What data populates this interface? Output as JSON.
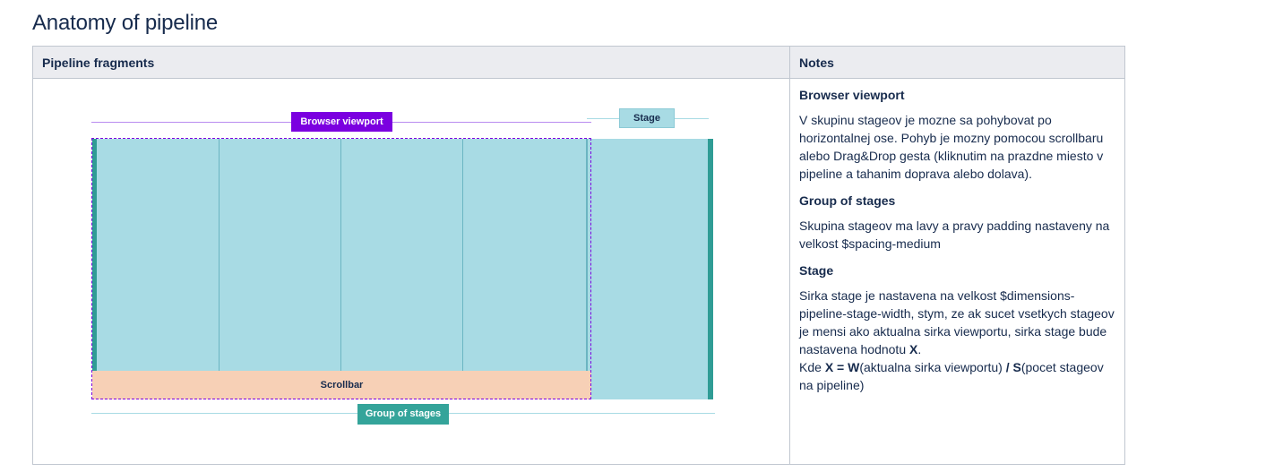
{
  "page": {
    "title": "Anatomy of pipeline"
  },
  "table": {
    "headers": [
      "Pipeline fragments",
      "Notes"
    ]
  },
  "diagram": {
    "labels": {
      "browser_viewport": "Browser viewport",
      "stage": "Stage",
      "scrollbar": "Scrollbar",
      "group_of_stages": "Group of stages"
    },
    "colors": {
      "viewport_purple": "#7b00e0",
      "stage_fill": "#a8dbe4",
      "stage_border": "#6bb5c2",
      "scrollbar_fill": "#f7d0b6",
      "group_teal": "#34a49a",
      "edge_teal": "#2f9c95"
    }
  },
  "notes": {
    "browser_viewport": {
      "heading": "Browser viewport",
      "text": "V skupinu stageov je mozne sa pohybovat po horizontalnej ose. Pohyb je mozny pomocou scrollbaru alebo Drag&Drop gesta (kliknutim na prazdne miesto v pipeline a tahanim doprava alebo dolava)."
    },
    "group_of_stages": {
      "heading": "Group of stages",
      "text": "Skupina stageov ma lavy a pravy padding nastaveny na velkost $spacing-medium"
    },
    "stage": {
      "heading": "Stage",
      "text": "Sirka stage je nastavena na velkost $dimensions-pipeline-stage-width, stym, ze ak sucet vsetkych stageov je mensi ako aktualna sirka viewportu, sirka stage bude nastavena hodnotu",
      "bold_x": "X",
      "period": ".",
      "formula_intro": "Kde",
      "formula_x_eq_w": "X = W",
      "formula_w_desc": "(aktualna sirka viewportu)",
      "formula_div_s": "/ S",
      "formula_s_desc": "(pocet stageov na pipeline)"
    }
  }
}
